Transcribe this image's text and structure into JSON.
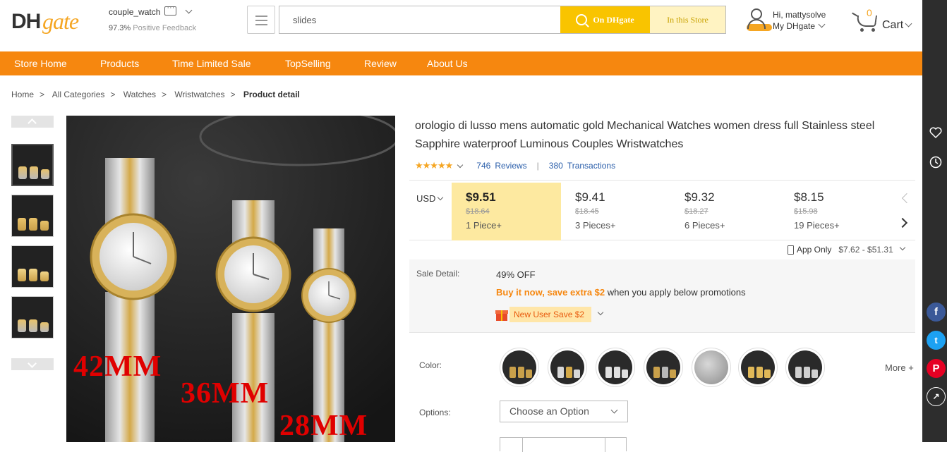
{
  "header": {
    "logo_dh": "DH",
    "logo_gate": "gate",
    "store_name": "couple_watch",
    "feedback_pct": "97.3%",
    "feedback_label": "Positive Feedback",
    "search_value": "slides",
    "search_btn": "On DHgate",
    "store_btn": "In this Store",
    "greeting": "Hi, mattysolve",
    "my_account": "My DHgate",
    "cart_count": "0",
    "cart_label": "Cart"
  },
  "nav": [
    {
      "label": "Store Home"
    },
    {
      "label": "Products"
    },
    {
      "label": "Time Limited Sale"
    },
    {
      "label": "TopSelling"
    },
    {
      "label": "Review"
    },
    {
      "label": "About Us"
    }
  ],
  "breadcrumb": [
    "Home",
    "All Categories",
    "Watches",
    "Wristwatches",
    "Product detail"
  ],
  "product": {
    "title": "orologio di lusso mens automatic gold Mechanical Watches women dress full Stainless steel Sapphire waterproof Luminous Couples Wristwatches",
    "stars": "★★★★★",
    "reviews_count": "746",
    "reviews_label": "Reviews",
    "transactions_count": "380",
    "transactions_label": "Transactions",
    "image_labels": [
      "42MM",
      "36MM",
      "28MM"
    ]
  },
  "pricing": {
    "currency": "USD",
    "tiers": [
      {
        "price": "$9.51",
        "old": "$18.64",
        "qty": "1 Piece+"
      },
      {
        "price": "$9.41",
        "old": "$18.45",
        "qty": "3 Pieces+"
      },
      {
        "price": "$9.32",
        "old": "$18.27",
        "qty": "6 Pieces+"
      },
      {
        "price": "$8.15",
        "old": "$15.98",
        "qty": "19 Pieces+"
      }
    ],
    "app_only_label": "App Only",
    "app_only_range": "$7.62 - $51.31"
  },
  "sale": {
    "label": "Sale Detail:",
    "off": "49% OFF",
    "promo_highlight": "Buy it now, save extra $2",
    "promo_rest": " when you apply below promotions",
    "coupon": "New User Save $2"
  },
  "options": {
    "color_label": "Color:",
    "more_label": "More",
    "options_label": "Options:",
    "select_value": "Choose an Option"
  },
  "colors": {
    "accent_orange": "#f6870f",
    "search_yellow": "#f9c400",
    "price_highlight": "#fde9a0",
    "link_blue": "#2a5eaa"
  }
}
